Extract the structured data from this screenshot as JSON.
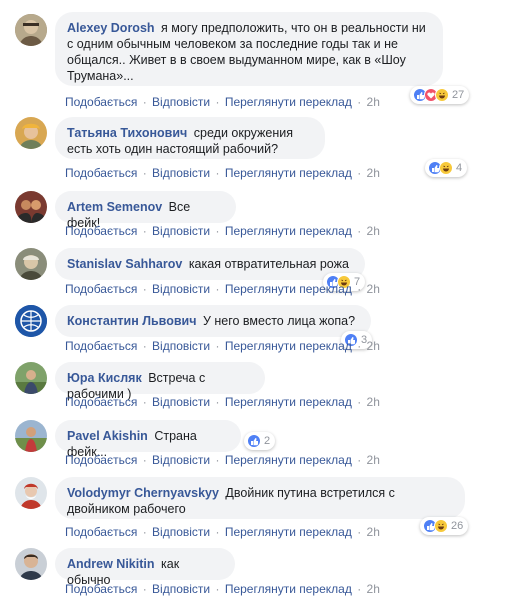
{
  "labels": {
    "like": "Подобається",
    "reply": "Відповісти",
    "translate": "Переглянути переклад",
    "sep": "·"
  },
  "colors": {
    "author": "#385898",
    "bubble": "#f2f3f5",
    "meta": "#90949c",
    "like": "#4f80f5",
    "love": "#f25268",
    "haha": "#f7c93b"
  },
  "comments": [
    {
      "author": "Alexey Dorosh",
      "text": "я могу предположить, что он в реальности ни с одним обычным человеком за последние годы так и не общался.. Живет в в своем выдуманном мире, как в «Шоу Трумана»...",
      "time": "2h",
      "reactions": [
        "like",
        "love",
        "haha"
      ],
      "reaction_count": "27"
    },
    {
      "author": "Татьяна Тихонович",
      "text": "среди окружения есть хоть один настоящий рабочий?",
      "time": "2h",
      "reactions": [
        "like",
        "haha"
      ],
      "reaction_count": "4"
    },
    {
      "author": "Artem Semenov",
      "text": "Все фейк!",
      "time": "2h",
      "reactions": [],
      "reaction_count": ""
    },
    {
      "author": "Stanislav Sahharov",
      "text": "какая отвратительная рожа",
      "time": "2h",
      "reactions": [
        "like",
        "haha"
      ],
      "reaction_count": "7"
    },
    {
      "author": "Константин Львович",
      "text": "У него вместо лица жопа?",
      "time": "2h",
      "reactions": [
        "like"
      ],
      "reaction_count": "3"
    },
    {
      "author": "Юра Кисляк",
      "text": "Встреча с рабочими  )",
      "time": "2h",
      "reactions": [],
      "reaction_count": ""
    },
    {
      "author": "Pavel Akishin",
      "text": "Страна фейк...",
      "time": "2h",
      "reactions": [
        "like"
      ],
      "reaction_count": "2"
    },
    {
      "author": "Volodymyr Chernyavskyy",
      "text": "Двойник путина встретился с двойником рабочего",
      "time": "2h",
      "reactions": [
        "like",
        "haha"
      ],
      "reaction_count": "26"
    },
    {
      "author": "Andrew Nikitin",
      "text": "как обычно",
      "time": "2h",
      "reactions": [],
      "reaction_count": ""
    }
  ]
}
